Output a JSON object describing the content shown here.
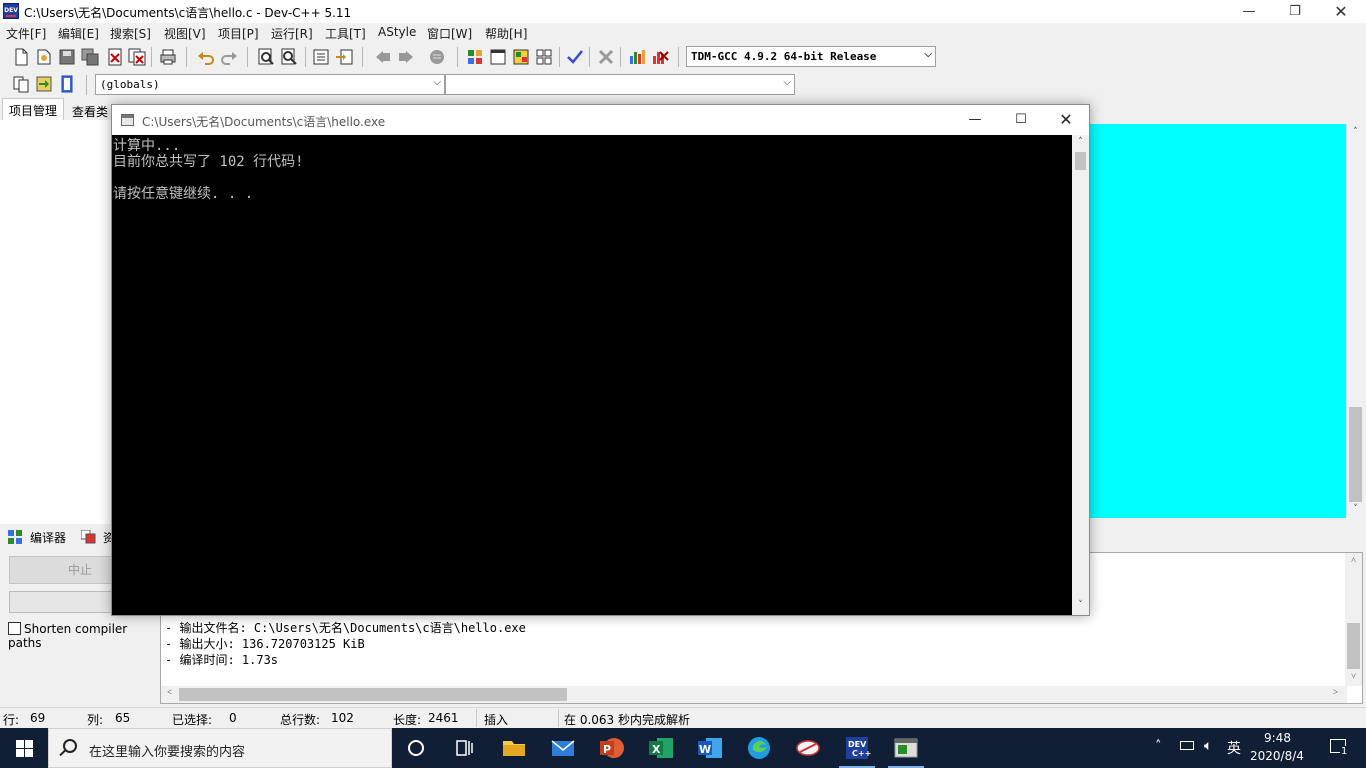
{
  "window": {
    "title": "C:\\Users\\无名\\Documents\\c语言\\hello.c - Dev-C++ 5.11",
    "icon_text": "DEV"
  },
  "menu": [
    "文件[F]",
    "编辑[E]",
    "搜索[S]",
    "视图[V]",
    "项目[P]",
    "运行[R]",
    "工具[T]",
    "AStyle",
    "窗口[W]",
    "帮助[H]"
  ],
  "toolbar": {
    "compiler": "TDM-GCC 4.9.2 64-bit Release",
    "scope": "(globals)",
    "function": ""
  },
  "left_tabs": [
    "项目管理",
    "查看类"
  ],
  "bottom_tabs": [
    "编译器",
    "资"
  ],
  "compile_panel": {
    "abort_label": "中止",
    "shorten_label": "Shorten compiler paths",
    "output_lines": [
      "- 输出文件名: C:\\Users\\无名\\Documents\\c语言\\hello.exe",
      "- 输出大小: 136.720703125 KiB",
      "- 编译时间: 1.73s"
    ]
  },
  "status": {
    "row_label": "行:",
    "row": "69",
    "col_label": "列:",
    "col": "65",
    "sel_label": "已选择:",
    "sel": "0",
    "total_label": "总行数:",
    "total": "102",
    "len_label": "长度:",
    "len": "2461",
    "mode": "插入",
    "parse": "在 0.063 秒内完成解析"
  },
  "console": {
    "title": "C:\\Users\\无名\\Documents\\c语言\\hello.exe",
    "lines": [
      "计算中...",
      "目前你总共写了 102 行代码!",
      "",
      "请按任意键继续. . ."
    ]
  },
  "taskbar": {
    "search_placeholder": "在这里输入你要搜索的内容",
    "time": "9:48",
    "date": "2020/8/4",
    "ime": "英",
    "notifications": "1"
  },
  "colors": {
    "editor_bg": "#00ffff",
    "console_bg": "#000000",
    "console_fg": "#c0c0c0",
    "taskbar_bg": "#101e36"
  }
}
